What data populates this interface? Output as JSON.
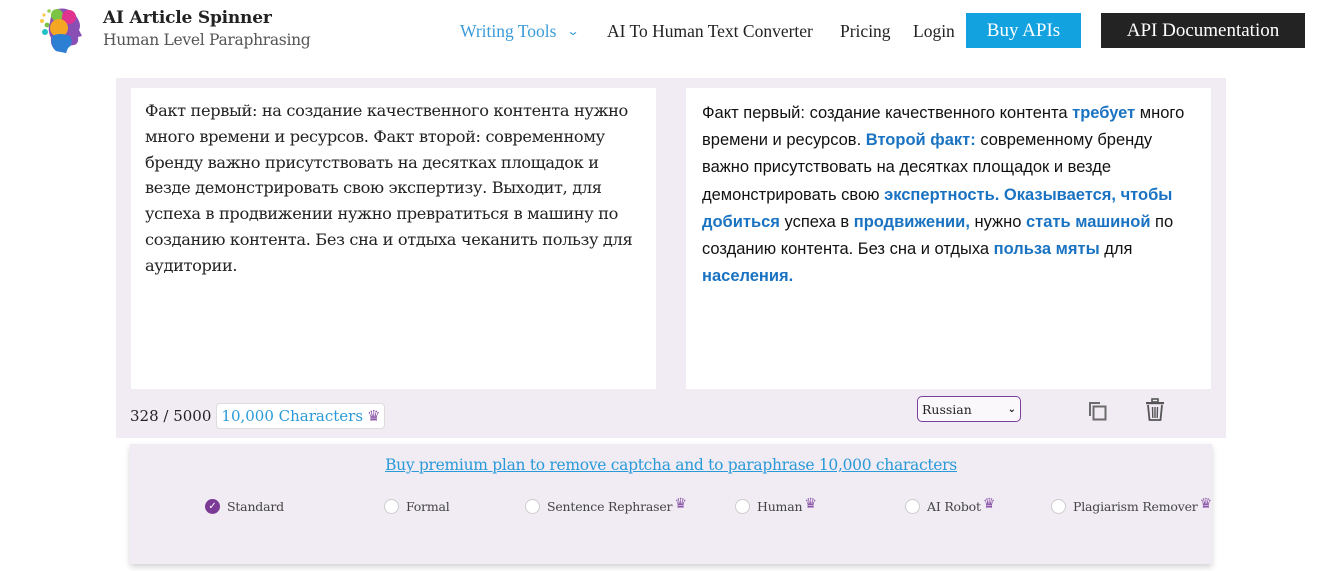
{
  "header": {
    "brand_title": "AI Article Spinner",
    "brand_subtitle": "Human Level Paraphrasing",
    "nav": {
      "writing_tools": "Writing Tools",
      "writing_tools_chevron": "⌄",
      "ai_to_human": "AI To Human Text Converter",
      "pricing": "Pricing",
      "login": "Login"
    },
    "buy_apis": "Buy APIs",
    "api_docs": "API Documentation",
    "colors": {
      "accent": "#12a2e0",
      "dark": "#232323",
      "link": "#3a9bd9"
    }
  },
  "editor": {
    "input_text": "Факт первый: на создание качественного контента нужно много времени и ресурсов. Факт второй: современному бренду важно присутствовать на десятках площадок и везде демонстрировать свою экспертизу. Выходит, для успеха в продвижении нужно превратиться в машину по созданию контента. Без сна и отдыха чеканить пользу для аудитории.",
    "output_segments": [
      {
        "text": "Факт первый: создание качественного контента ",
        "hl": false
      },
      {
        "text": "требует",
        "hl": true
      },
      {
        "text": " много времени и ресурсов. ",
        "hl": false
      },
      {
        "text": "Второй факт:",
        "hl": true
      },
      {
        "text": " современному бренду важно присутствовать на десятках площадок и везде демонстрировать свою ",
        "hl": false
      },
      {
        "text": "экспертность. Оказывается, чтобы добиться",
        "hl": true
      },
      {
        "text": " успеха в ",
        "hl": false
      },
      {
        "text": "продвижении,",
        "hl": true
      },
      {
        "text": " нужно ",
        "hl": false
      },
      {
        "text": "стать машиной",
        "hl": true
      },
      {
        "text": " по созданию контента. Без сна и отдыха ",
        "hl": false
      },
      {
        "text": "польза мяты",
        "hl": true
      },
      {
        "text": " для ",
        "hl": false
      },
      {
        "text": "населения.",
        "hl": true
      }
    ],
    "char_count": "328 / 5000",
    "char_upgrade": "10,000 Characters",
    "crown_glyph": "♛",
    "language_selected": "Russian",
    "select_chevron": "⌄",
    "highlight_color": "#1a73c2"
  },
  "options": {
    "premium_link": "Buy premium plan to remove captcha and to paraphrase 10,000 characters",
    "check_glyph": "✓",
    "modes": [
      {
        "label": "Standard",
        "checked": true,
        "premium": false
      },
      {
        "label": "Formal",
        "checked": false,
        "premium": false
      },
      {
        "label": "Sentence Rephraser",
        "checked": false,
        "premium": true
      },
      {
        "label": "Human",
        "checked": false,
        "premium": true
      },
      {
        "label": "AI Robot",
        "checked": false,
        "premium": true
      },
      {
        "label": "Plagiarism Remover",
        "checked": false,
        "premium": true
      }
    ]
  }
}
